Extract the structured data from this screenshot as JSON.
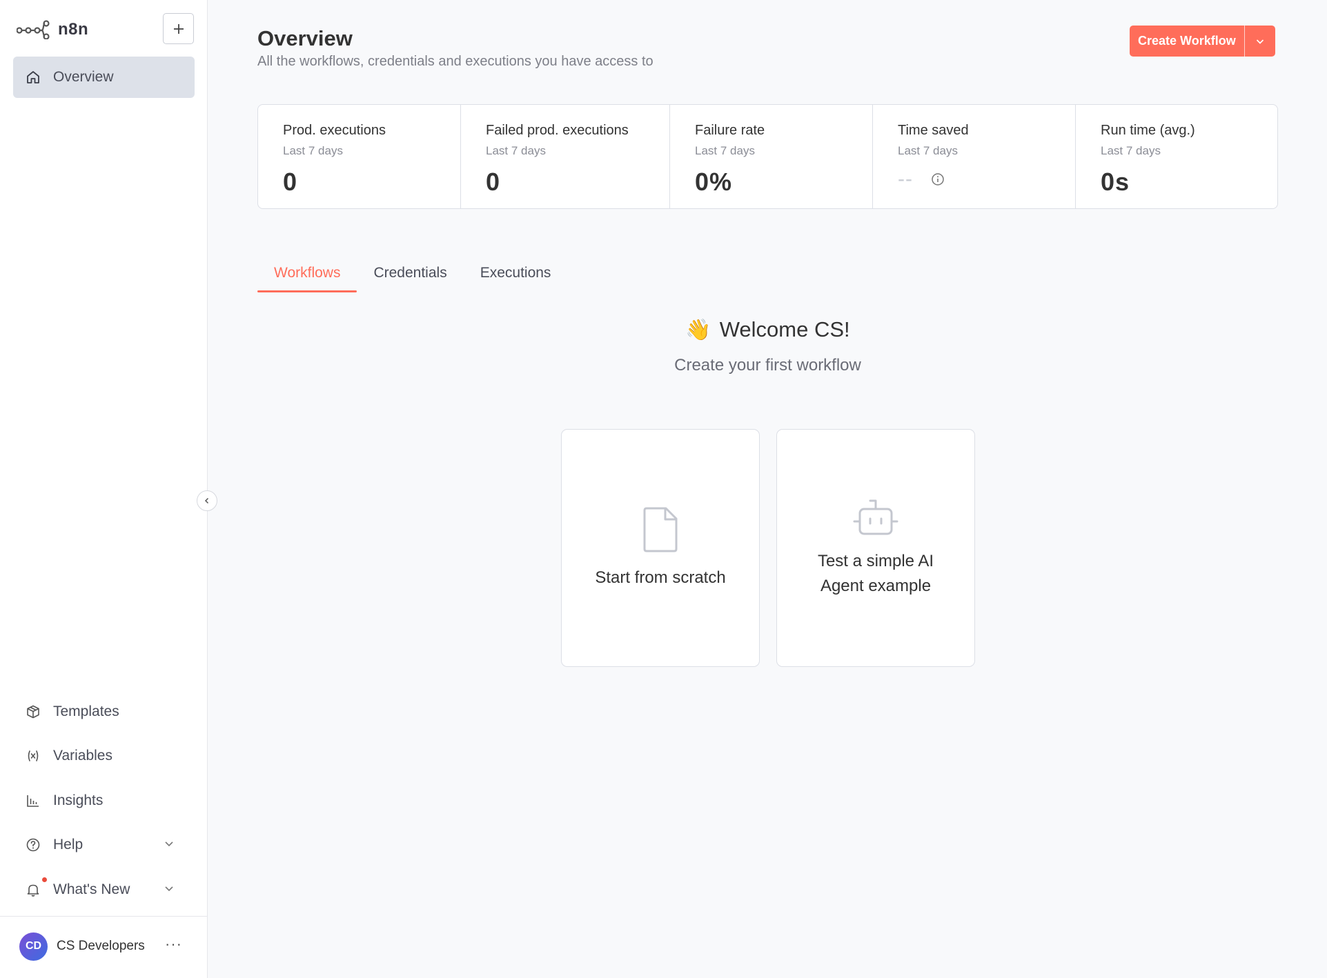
{
  "app": {
    "logo_text": "n8n"
  },
  "sidebar": {
    "active_item": {
      "label": "Overview",
      "icon": "home-icon"
    },
    "bottom_items": [
      {
        "label": "Templates",
        "icon": "box-icon"
      },
      {
        "label": "Variables",
        "icon": "variable-icon"
      },
      {
        "label": "Insights",
        "icon": "bar-chart-icon"
      },
      {
        "label": "Help",
        "icon": "help-circle-icon"
      },
      {
        "label": "What's New",
        "icon": "bell-icon"
      }
    ],
    "user": {
      "initials": "CD",
      "name": "CS Developers",
      "menu": "···"
    }
  },
  "header": {
    "title": "Overview",
    "subtitle": "All the workflows, credentials and executions you have access to",
    "create_button": "Create Workflow"
  },
  "stats": [
    {
      "title": "Prod. executions",
      "period": "Last 7 days",
      "value": "0"
    },
    {
      "title": "Failed prod. executions",
      "period": "Last 7 days",
      "value": "0"
    },
    {
      "title": "Failure rate",
      "period": "Last 7 days",
      "value": "0%"
    },
    {
      "title": "Time saved",
      "period": "Last 7 days",
      "value": "--"
    },
    {
      "title": "Run time (avg.)",
      "period": "Last 7 days",
      "value": "0s"
    }
  ],
  "tabs": [
    {
      "label": "Workflows",
      "active": true
    },
    {
      "label": "Credentials",
      "active": false
    },
    {
      "label": "Executions",
      "active": false
    }
  ],
  "welcome": {
    "emoji": "👋",
    "title": "Welcome CS!",
    "subtitle": "Create your first workflow"
  },
  "cards": [
    {
      "label": "Start from scratch",
      "icon": "file-icon"
    },
    {
      "label": "Test a simple AI Agent example",
      "icon": "robot-icon"
    }
  ],
  "colors": {
    "accent": "#ff6d5a",
    "sidebar_active_bg": "#dde1e9",
    "page_bg": "#f8f9fb",
    "notification_dot": "#ea4b3b"
  }
}
